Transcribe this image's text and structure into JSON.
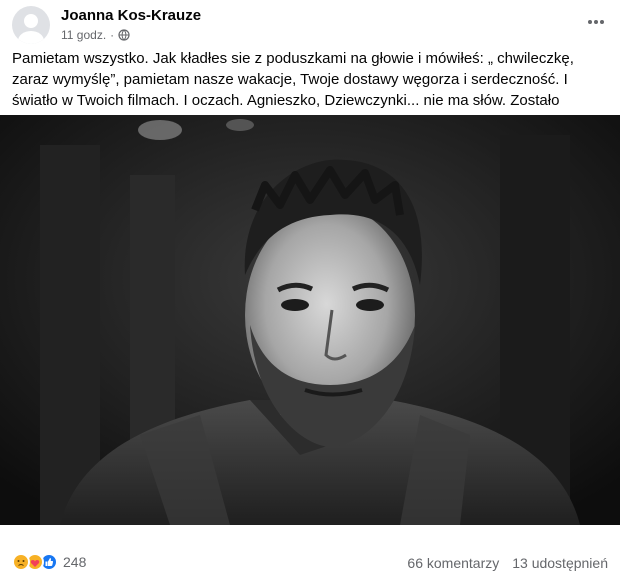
{
  "post": {
    "author": "Joanna Kos-Krauze",
    "time": "11 godz.",
    "separator": "·",
    "text": "Pamietam wszystko. Jak kładłes sie z poduszkami na głowie i mówiłeś: „ chwileczkę, zaraz wymyślę”, pamietam nasze wakacje, Twoje dostawy węgorza i serdeczność. I światło w Twoich filmach. I oczach. Agnieszko, Dziewczynki... nie ma słów. Zostało światło."
  },
  "footer": {
    "reaction_count": "248",
    "reactions": [
      "sad-icon",
      "care-icon",
      "like-icon"
    ],
    "comments": "66 komentarzy",
    "shares": "13 udostępnień"
  },
  "colors": {
    "text": "#050505",
    "secondary": "#65676b",
    "like": "#1877f2",
    "sad": "#f7b125"
  }
}
